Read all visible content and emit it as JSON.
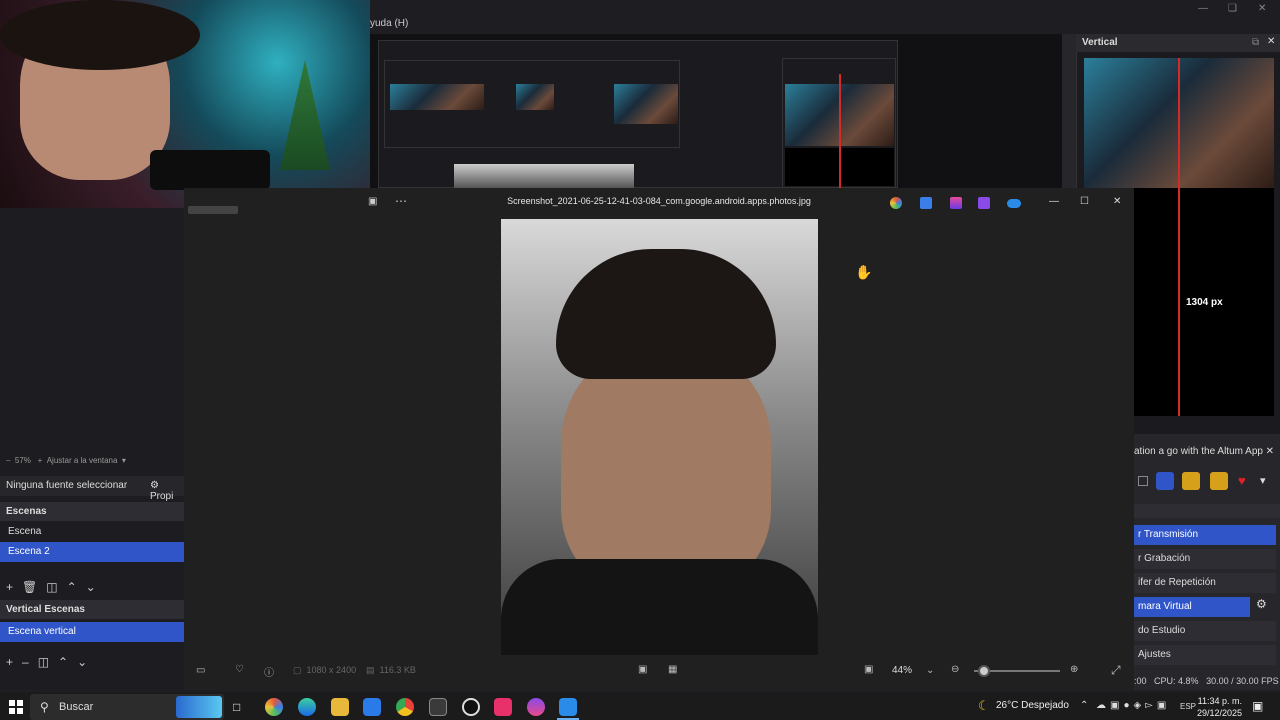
{
  "obs": {
    "menu_help": "yuda (H)",
    "vertical_title": "Vertical",
    "vertical_px_label": "1304 px",
    "zoom_percent": "57%",
    "zoom_fit": "Ajustar a la ventana",
    "no_source": "Ninguna fuente seleccionar",
    "properties": "Propi",
    "scenes_title": "Escenas",
    "scenes": [
      {
        "label": "Escena",
        "selected": false
      },
      {
        "label": "Escena 2",
        "selected": true
      }
    ],
    "vertical_scenes_title": "Vertical Escenas",
    "vertical_scenes": [
      {
        "label": "Escena vertical",
        "selected": true
      }
    ],
    "altum_text": "ation a go with the Altum App",
    "controls": [
      {
        "label": "r Transmisión",
        "active": true
      },
      {
        "label": "r Grabación",
        "active": false
      },
      {
        "label": "ifer de Repetición",
        "active": false
      },
      {
        "label": "mara Virtual",
        "active": true
      },
      {
        "label": "do Estudio",
        "active": false
      },
      {
        "label": "Ajustes",
        "active": false
      }
    ],
    "status_cpu": "CPU: 4.8%",
    "status_fps": "30.00 / 30.00 FPS",
    "status_prefix": ":00"
  },
  "photos": {
    "title": "Screenshot_2021-06-25-12-41-03-084_com.google.android.apps.photos.jpg",
    "resolution": "1080 x 2400",
    "filesize": "116.3 KB",
    "zoom": "44%"
  },
  "taskbar": {
    "search_placeholder": "Buscar",
    "weather": "26°C  Despejado",
    "language": "ESP",
    "time": "11:34 p. m.",
    "date": "29/12/2025"
  },
  "colors": {
    "accent": "#2f55c9",
    "red_guide": "#d32a2a"
  }
}
